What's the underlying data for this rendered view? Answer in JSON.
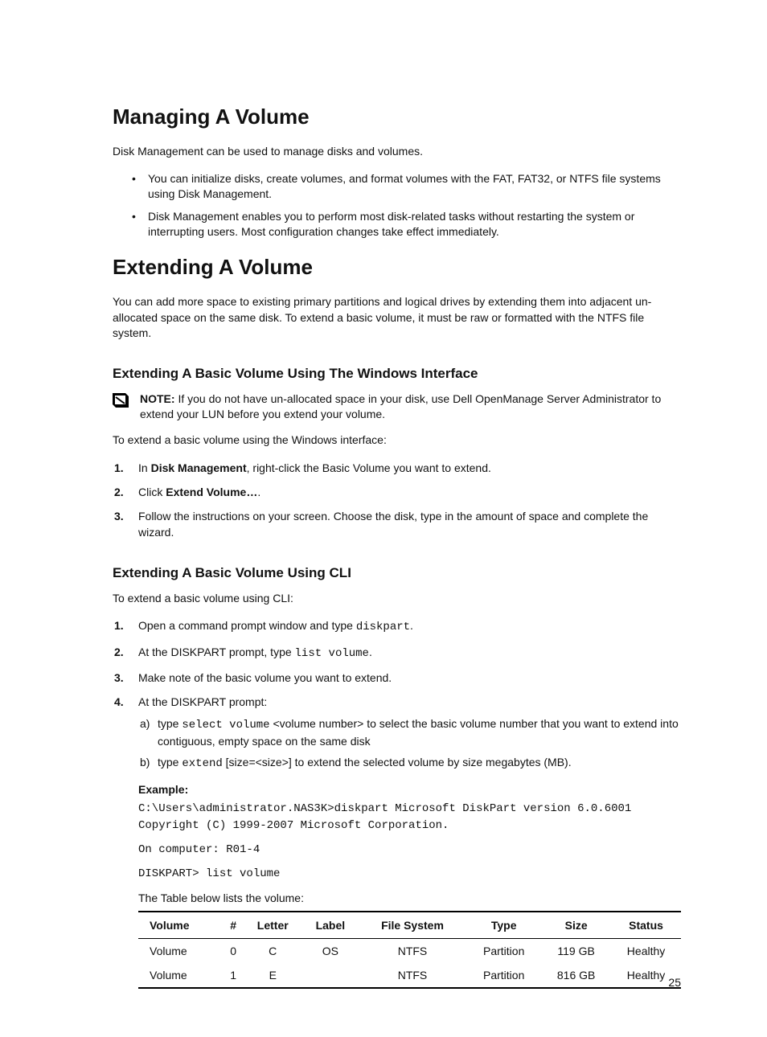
{
  "h1_managing": "Managing A Volume",
  "p_dm_intro": "Disk Management can be used to manage disks and volumes.",
  "bullets_manage": [
    "You can initialize disks, create volumes, and format volumes with the FAT, FAT32, or NTFS file systems using Disk Management.",
    "Disk Management enables you to perform most disk-related tasks without restarting the system or interrupting users. Most configuration changes take effect immediately."
  ],
  "h1_extending": "Extending A Volume",
  "p_extending": "You can add more space to existing primary partitions and logical drives by extending them into adjacent un-allocated space on the same disk. To extend a basic volume, it must be raw or formatted with the NTFS file system.",
  "h2_win": "Extending A Basic Volume Using The Windows Interface",
  "note_prefix": "NOTE:",
  "note_text": " If you do not have un-allocated space in your disk, use Dell OpenManage Server Administrator to extend your LUN before you extend your volume.",
  "p_win_intro": "To extend a basic volume using the Windows interface:",
  "win_step1_pre": "In ",
  "win_step1_bold": "Disk Management",
  "win_step1_post": ", right-click the Basic Volume you want to extend.",
  "win_step2_pre": "Click ",
  "win_step2_bold": "Extend Volume…",
  "win_step2_post": ".",
  "win_step3": "Follow the instructions on your screen. Choose the disk, type in the amount of space and complete the wizard.",
  "h2_cli": "Extending A Basic Volume Using CLI",
  "p_cli_intro": "To extend a basic volume using CLI:",
  "cli_step1_pre": "Open a command prompt window and type ",
  "cli_step1_code": "diskpart",
  "cli_step1_post": ".",
  "cli_step2_pre": "At the DISKPART prompt, type ",
  "cli_step2_code": "list volume",
  "cli_step2_post": ".",
  "cli_step3": "Make note of the basic volume you want to extend.",
  "cli_step4": "At the DISKPART prompt:",
  "cli_sub_a_pre": "type ",
  "cli_sub_a_code": "select volume",
  "cli_sub_a_post": " <volume number> to select the basic volume number that you want to extend into contiguous, empty space on the same disk",
  "cli_sub_b_pre": "type ",
  "cli_sub_b_code": "extend",
  "cli_sub_b_post": " [size=<size>] to extend the selected volume by size megabytes (MB).",
  "example_label": "Example:",
  "code_block1": "C:\\Users\\administrator.NAS3K>diskpart Microsoft DiskPart version 6.0.6001 Copyright (C) 1999-2007 Microsoft Corporation.",
  "code_block2": "On computer: R01-4",
  "code_block3": "DISKPART> list volume",
  "table_caption": "The Table below lists the volume:",
  "chart_data": {
    "type": "table",
    "columns": [
      "Volume",
      "#",
      "Letter",
      "Label",
      "File System",
      "Type",
      "Size",
      "Status"
    ],
    "rows": [
      [
        "Volume",
        "0",
        "C",
        "OS",
        "NTFS",
        "Partition",
        "119 GB",
        "Healthy"
      ],
      [
        "Volume",
        "1",
        "E",
        "",
        "NTFS",
        "Partition",
        "816 GB",
        "Healthy"
      ]
    ]
  },
  "page_number": "25"
}
